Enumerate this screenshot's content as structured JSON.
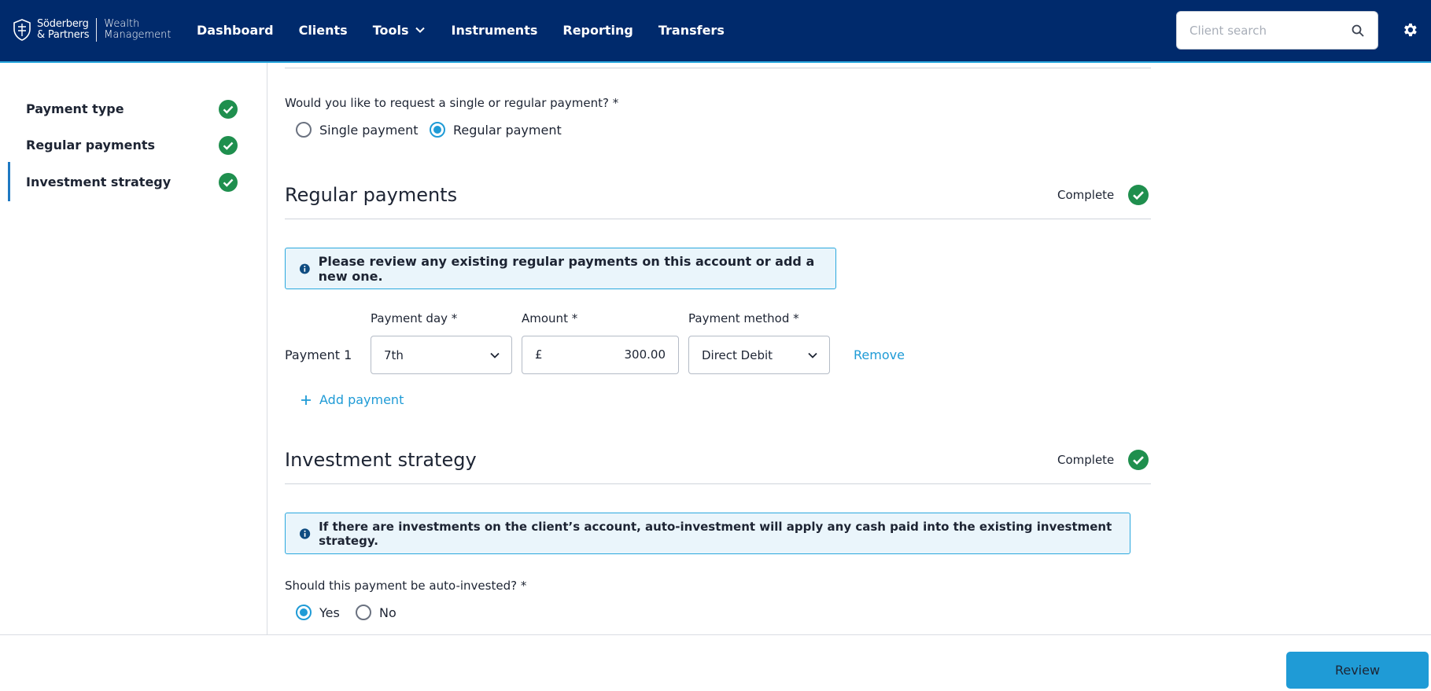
{
  "header": {
    "logo": {
      "brand_line1": "Söderberg",
      "brand_line2": "& Partners",
      "wm_line1": "Wealth",
      "wm_line2": "Management"
    },
    "nav": [
      {
        "label": "Dashboard"
      },
      {
        "label": "Clients"
      },
      {
        "label": "Tools",
        "has_dropdown": true
      },
      {
        "label": "Instruments"
      },
      {
        "label": "Reporting"
      },
      {
        "label": "Transfers"
      }
    ],
    "search": {
      "placeholder": "Client search",
      "value": "",
      "icon": "search-icon"
    },
    "settings_icon": "gear-icon"
  },
  "sidebar": {
    "items": [
      {
        "label": "Payment type",
        "complete": true
      },
      {
        "label": "Regular payments",
        "complete": true
      },
      {
        "label": "Investment strategy",
        "complete": true,
        "active": true
      }
    ]
  },
  "payment_type": {
    "question": "Would you like to request a single or regular payment? *",
    "options": [
      {
        "label": "Single payment",
        "selected": false
      },
      {
        "label": "Regular payment",
        "selected": true
      }
    ]
  },
  "regular_payments": {
    "title": "Regular payments",
    "status": "Complete",
    "info": "Please review any existing regular payments on this account or add a new one.",
    "labels": {
      "payment_day": "Payment day *",
      "amount": "Amount *",
      "payment_method": "Payment method *"
    },
    "payments": [
      {
        "label": "Payment 1",
        "day": "7th",
        "currency": "£",
        "amount": "300.00",
        "method": "Direct Debit",
        "remove_label": "Remove"
      }
    ],
    "add_label": "Add payment"
  },
  "investment_strategy": {
    "title": "Investment strategy",
    "status": "Complete",
    "info": "If there are investments on the client’s account, auto-investment will apply any cash paid into the existing investment strategy.",
    "question": "Should this payment be auto-invested? *",
    "options": [
      {
        "label": "Yes",
        "selected": true
      },
      {
        "label": "No",
        "selected": false
      }
    ]
  },
  "footer": {
    "review_label": "Review"
  },
  "colors": {
    "header_bg": "#002a6c",
    "accent": "#1f9bd6",
    "complete_green": "#1f8f4e"
  }
}
